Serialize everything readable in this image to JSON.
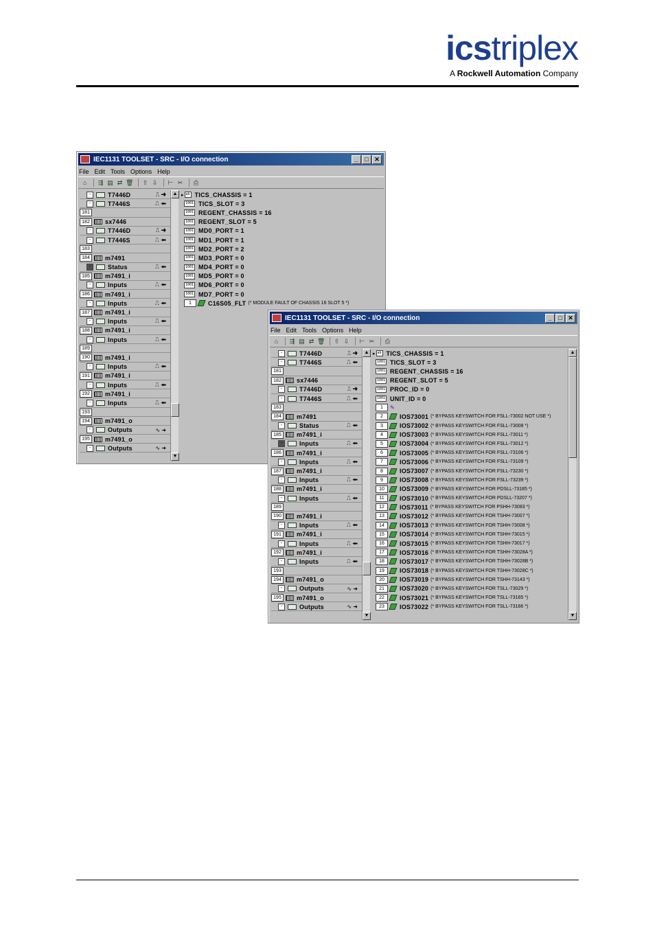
{
  "logo": {
    "part1": "ics",
    "part2": "triplex",
    "tagline_prefix": "A ",
    "tagline_brand": "Rockwell Automation",
    "tagline_suffix": " Company"
  },
  "colors": {
    "logo_blue": "#1e3f8f",
    "titlebar": "#0a246a",
    "bool_green": "#3aa03a"
  },
  "window1": {
    "title": "IEC1131 TOOLSET - SRC - I/O connection",
    "menu": [
      "File",
      "Edit",
      "Tools",
      "Options",
      "Help"
    ],
    "left_rows": [
      {
        "kind": "ch",
        "label": "T7446D",
        "dir": "⎍ ➜"
      },
      {
        "kind": "ch",
        "label": "T7446S",
        "dir": "⎍ ⬅"
      },
      {
        "kind": "num",
        "num": "181",
        "label": ""
      },
      {
        "kind": "mod",
        "num": "182",
        "label": "sx7446"
      },
      {
        "kind": "ch",
        "label": "T7446D",
        "dir": "⎍ ➜"
      },
      {
        "kind": "ch",
        "label": "T7446S",
        "dir": "⎍ ⬅"
      },
      {
        "kind": "num",
        "num": "183",
        "label": ""
      },
      {
        "kind": "mod",
        "num": "184",
        "label": "m7491"
      },
      {
        "kind": "chd",
        "label": "Status",
        "dir": "⎍ ⬅"
      },
      {
        "kind": "mod",
        "num": "185",
        "label": "m7491_i"
      },
      {
        "kind": "ch",
        "label": "Inputs",
        "dir": "⎍ ⬅"
      },
      {
        "kind": "mod",
        "num": "186",
        "label": "m7491_i"
      },
      {
        "kind": "ch",
        "label": "Inputs",
        "dir": "⎍ ⬅"
      },
      {
        "kind": "mod",
        "num": "187",
        "label": "m7491_i"
      },
      {
        "kind": "ch",
        "label": "Inputs",
        "dir": "⎍ ⬅"
      },
      {
        "kind": "mod",
        "num": "188",
        "label": "m7491_i"
      },
      {
        "kind": "ch",
        "label": "Inputs",
        "dir": "⎍ ⬅"
      },
      {
        "kind": "num",
        "num": "189",
        "label": ""
      },
      {
        "kind": "mod",
        "num": "190",
        "label": "m7491_i"
      },
      {
        "kind": "ch",
        "label": "Inputs",
        "dir": "⎍ ⬅"
      },
      {
        "kind": "mod",
        "num": "191",
        "label": "m7491_i"
      },
      {
        "kind": "ch",
        "label": "Inputs",
        "dir": "⎍ ⬅"
      },
      {
        "kind": "mod",
        "num": "192",
        "label": "m7491_i"
      },
      {
        "kind": "ch",
        "label": "Inputs",
        "dir": "⎍ ⬅"
      },
      {
        "kind": "num",
        "num": "193",
        "label": ""
      },
      {
        "kind": "mod",
        "num": "194",
        "label": "m7491_o"
      },
      {
        "kind": "ch",
        "label": "Outputs",
        "dir": "∿ ➜"
      },
      {
        "kind": "mod",
        "num": "195",
        "label": "m7491_o"
      },
      {
        "kind": "ch",
        "label": "Outputs",
        "dir": "∿ ➜"
      }
    ],
    "right_rows": [
      {
        "kind": "param",
        "first": true,
        "label": "TICS_CHASSIS = 1"
      },
      {
        "kind": "param",
        "label": "TICS_SLOT = 3"
      },
      {
        "kind": "param",
        "label": "REGENT_CHASSIS = 16"
      },
      {
        "kind": "param",
        "label": "REGENT_SLOT = 5"
      },
      {
        "kind": "param",
        "label": "MD0_PORT = 1"
      },
      {
        "kind": "param",
        "label": "MD1_PORT = 1"
      },
      {
        "kind": "param",
        "label": "MD2_PORT = 2"
      },
      {
        "kind": "param",
        "label": "MD3_PORT = 0"
      },
      {
        "kind": "param",
        "label": "MD4_PORT = 0"
      },
      {
        "kind": "param",
        "label": "MD5_PORT = 0"
      },
      {
        "kind": "param",
        "label": "MD6_PORT = 0"
      },
      {
        "kind": "param",
        "label": "MD7_PORT = 0"
      },
      {
        "kind": "var",
        "num": "1",
        "label": "C16S05_FLT",
        "comment": "(* MODULE FAULT OF CHASSIS 16 SLOT 5 *)"
      }
    ]
  },
  "window2": {
    "title": "IEC1131 TOOLSET - SRC - I/O connection",
    "menu": [
      "File",
      "Edit",
      "Tools",
      "Options",
      "Help"
    ],
    "left_rows": [
      {
        "kind": "ch",
        "label": "T7446D",
        "dir": "⎍ ➜"
      },
      {
        "kind": "ch",
        "label": "T7446S",
        "dir": "⎍ ⬅"
      },
      {
        "kind": "num",
        "num": "181",
        "label": ""
      },
      {
        "kind": "mod",
        "num": "182",
        "label": "sx7446"
      },
      {
        "kind": "ch",
        "label": "T7446D",
        "dir": "⎍ ➜"
      },
      {
        "kind": "ch",
        "label": "T7446S",
        "dir": "⎍ ⬅"
      },
      {
        "kind": "num",
        "num": "183",
        "label": ""
      },
      {
        "kind": "mod",
        "num": "184",
        "label": "m7491"
      },
      {
        "kind": "ch",
        "label": "Status",
        "dir": "⎍ ⬅"
      },
      {
        "kind": "mod",
        "num": "185",
        "label": "m7491_i"
      },
      {
        "kind": "chd",
        "label": "Inputs",
        "dir": "⎍ ⬅"
      },
      {
        "kind": "mod",
        "num": "186",
        "label": "m7491_i"
      },
      {
        "kind": "ch",
        "label": "Inputs",
        "dir": "⎍ ⬅"
      },
      {
        "kind": "mod",
        "num": "187",
        "label": "m7491_i"
      },
      {
        "kind": "ch",
        "label": "Inputs",
        "dir": "⎍ ⬅"
      },
      {
        "kind": "mod",
        "num": "188",
        "label": "m7491_i"
      },
      {
        "kind": "ch",
        "label": "Inputs",
        "dir": "⎍ ⬅"
      },
      {
        "kind": "num",
        "num": "189",
        "label": ""
      },
      {
        "kind": "mod",
        "num": "190",
        "label": "m7491_i"
      },
      {
        "kind": "ch",
        "label": "Inputs",
        "dir": "⎍ ⬅"
      },
      {
        "kind": "mod",
        "num": "191",
        "label": "m7491_i"
      },
      {
        "kind": "ch",
        "label": "Inputs",
        "dir": "⎍ ⬅"
      },
      {
        "kind": "mod",
        "num": "192",
        "label": "m7491_i"
      },
      {
        "kind": "ch",
        "label": "Inputs",
        "dir": "⎍ ⬅"
      },
      {
        "kind": "num",
        "num": "193",
        "label": ""
      },
      {
        "kind": "mod",
        "num": "194",
        "label": "m7491_o"
      },
      {
        "kind": "ch",
        "label": "Outputs",
        "dir": "∿ ➜"
      },
      {
        "kind": "mod",
        "num": "195",
        "label": "m7491_o"
      },
      {
        "kind": "ch",
        "label": "Outputs",
        "dir": "∿ ➜"
      }
    ],
    "right_rows": [
      {
        "kind": "param",
        "first": true,
        "label": "TICS_CHASSIS = 1"
      },
      {
        "kind": "param",
        "label": "TICS_SLOT = 3"
      },
      {
        "kind": "param",
        "label": "REGENT_CHASSIS = 16"
      },
      {
        "kind": "param",
        "label": "REGENT_SLOT = 5"
      },
      {
        "kind": "param",
        "label": "PROC_ID = 0"
      },
      {
        "kind": "param",
        "label": "UNIT_ID = 0"
      },
      {
        "kind": "pen",
        "num": "1",
        "label": ""
      },
      {
        "kind": "var",
        "num": "2",
        "label": "IOS73001",
        "comment": "(* BYPASS KEYSWITCH FOR FSLL-73002 NOT USE *)"
      },
      {
        "kind": "var",
        "num": "3",
        "label": "IOS73002",
        "comment": "(* BYPASS KEYSWITCH FOR FSLL-73008 *)"
      },
      {
        "kind": "var",
        "num": "4",
        "label": "IOS73003",
        "comment": "(* BYPASS KEYSWITCH FOR FSLL-73011 *)"
      },
      {
        "kind": "var",
        "num": "5",
        "label": "IOS73004",
        "comment": "(* BYPASS KEYSWITCH FOR FSLL-73012 *)"
      },
      {
        "kind": "var",
        "num": "6",
        "label": "IOS73005",
        "comment": "(* BYPASS KEYSWITCH FOR FSLL-73106 *)"
      },
      {
        "kind": "var",
        "num": "7",
        "label": "IOS73006",
        "comment": "(* BYPASS KEYSWITCH FOR FSLL-73109 *)"
      },
      {
        "kind": "var",
        "num": "8",
        "label": "IOS73007",
        "comment": "(* BYPASS KEYSWITCH FOR FSLL-73230 *)"
      },
      {
        "kind": "var",
        "num": "9",
        "label": "IOS73008",
        "comment": "(* BYPASS KEYSWITCH FOR FSLL-73239 *)"
      },
      {
        "kind": "var",
        "num": "10",
        "label": "IOS73009",
        "comment": "(* BYPASS KEYSWITCH FOR PDSLL-73185 *)"
      },
      {
        "kind": "var",
        "num": "11",
        "label": "IOS73010",
        "comment": "(* BYPASS KEYSWITCH FOR PDSLL-73207 *)"
      },
      {
        "kind": "var",
        "num": "12",
        "label": "IOS73011",
        "comment": "(* BYPASS KEYSWITCH FOR PSHH-73083 *)"
      },
      {
        "kind": "var",
        "num": "13",
        "label": "IOS73012",
        "comment": "(* BYPASS KEYSWITCH FOR TSHH-73007 *)"
      },
      {
        "kind": "var",
        "num": "14",
        "label": "IOS73013",
        "comment": "(* BYPASS KEYSWITCH FOR TSHH-73008 *)"
      },
      {
        "kind": "var",
        "num": "15",
        "label": "IOS73014",
        "comment": "(* BYPASS KEYSWITCH FOR TSHH-73015 *)"
      },
      {
        "kind": "var",
        "num": "16",
        "label": "IOS73015",
        "comment": "(* BYPASS KEYSWITCH FOR TSHH-73017 *)"
      },
      {
        "kind": "var",
        "num": "17",
        "label": "IOS73016",
        "comment": "(* BYPASS KEYSWITCH FOR TSHH-73028A *)"
      },
      {
        "kind": "var",
        "num": "18",
        "label": "IOS73017",
        "comment": "(* BYPASS KEYSWITCH FOR TSHH-73028B *)"
      },
      {
        "kind": "var",
        "num": "19",
        "label": "IOS73018",
        "comment": "(* BYPASS KEYSWITCH FOR TSHH-73028C *)"
      },
      {
        "kind": "var",
        "num": "20",
        "label": "IOS73019",
        "comment": "(* BYPASS KEYSWITCH FOR TSHH-73143 *)"
      },
      {
        "kind": "var",
        "num": "21",
        "label": "IOS73020",
        "comment": "(* BYPASS KEYSWITCH FOR TSLL-73029 *)"
      },
      {
        "kind": "var",
        "num": "22",
        "label": "IOS73021",
        "comment": "(* BYPASS KEYSWITCH FOR TSLL-73165 *)"
      },
      {
        "kind": "var",
        "num": "23",
        "label": "IOS73022",
        "comment": "(* BYPASS KEYSWITCH FOR TSLL-73166 *)"
      }
    ]
  }
}
